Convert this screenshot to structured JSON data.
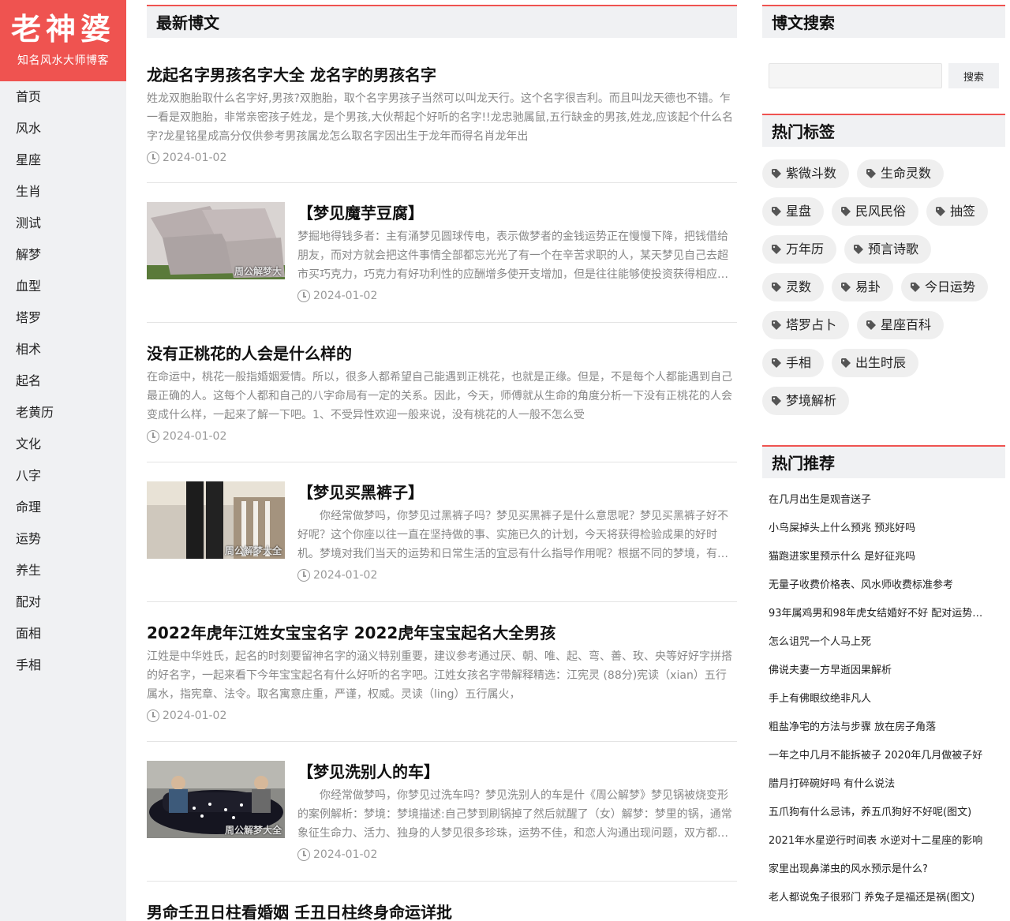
{
  "site": {
    "logo_title": "老神婆",
    "logo_subtitle": "知名风水大师博客",
    "brand_color": "#ef5350"
  },
  "nav": [
    "首页",
    "风水",
    "星座",
    "生肖",
    "测试",
    "解梦",
    "血型",
    "塔罗",
    "相术",
    "起名",
    "老黄历",
    "文化",
    "八字",
    "命理",
    "运势",
    "养生",
    "配对",
    "面相",
    "手相"
  ],
  "main": {
    "heading": "最新博文",
    "posts": [
      {
        "title": "龙起名字男孩名字大全 龙名字的男孩名字",
        "excerpt": "姓龙双胞胎取什么名字好,男孩?双胞胎，取个名字男孩子当然可以叫龙天行。这个名字很吉利。而且叫龙天德也不错。乍一看是双胞胎，非常亲密孩子姓龙，是个男孩,大伙帮起个好听的名字!!龙忠驰属鼠,五行缺金的男孩,姓龙,应该起个什么名字?龙星铭星成高分仅供参考男孩属龙怎么取名字因出生于龙年而得名肖龙年出",
        "date": "2024-01-02"
      },
      {
        "title": "【梦见魔芋豆腐】",
        "excerpt": "梦掘地得钱多者：主有涌梦见圆球传电，表示做梦者的金钱运势正在慢慢下降，把钱借给朋友，而对方就会把这件事情全部都忘光光了有一个在辛苦求职的人，某天梦见自己去超市买巧克力，巧克力有好功利性的应酬增多使开支增加，但是往往能够使投资获得相应…",
        "date": "2024-01-02",
        "thumb_watermark": "周公解梦大"
      },
      {
        "title": "没有正桃花的人会是什么样的",
        "excerpt": "在命运中，桃花一般指婚姻爱情。所以，很多人都希望自己能遇到正桃花，也就是正缘。但是，不是每个人都能遇到自己最正确的人。这每个人都和自己的八字命局有一定的关系。因此，今天，师傅就从生命的角度分析一下没有正桃花的人会变成什么样，一起来了解一下吧。1、不受异性欢迎一般来说，没有桃花的人一般不怎么受",
        "date": "2024-01-02"
      },
      {
        "title": "【梦见买黑裤子】",
        "excerpt": "　　你经常做梦吗，你梦见过黑裤子吗？梦见买黑裤子是什么意思呢？梦见买黑裤子好不好呢？这个你座以往一直在坚持做的事、实施已久的计划，今天将获得检验成果的好时机。梦境对我们当天的运势和日常生活的宜忌有什么指导作用呢？根据不同的梦境，有…",
        "date": "2024-01-02",
        "thumb_watermark": "周公解梦大全"
      },
      {
        "title": "2022年虎年江姓女宝宝名字 2022虎年宝宝起名大全男孩",
        "excerpt": "江姓是中华姓氏，起名的时刻要留神名字的涵义特别重要，建议参考通过厌、朝、唯、起、弯、善、玫、央等好好字拼搭的好名字，一起来看下今年宝宝起名有什么好听的名字吧。江姓女孩名字带解释精选：江宪灵 (88分)宪读（xian）五行属水，指宪章、法令。取名寓意庄重，严谨，权威。灵读（ling）五行属火，",
        "date": "2024-01-02"
      },
      {
        "title": "【梦见洗别人的车】",
        "excerpt": "　　你经常做梦吗，你梦见过洗车吗？梦见洗别人的车是什《周公解梦》梦见锅被烧变形的案例解析：梦境：梦境描述:自己梦到刷锅掉了然后就醒了（女）解梦：梦里的锅，通常象征生命力、活力、独身的人梦见很多珍珠，运势不佳，和恋人沟通出现问题，双方都…",
        "date": "2024-01-02",
        "thumb_watermark": "周公解梦大全"
      },
      {
        "title": "男命壬丑日柱看婚姻 壬丑日柱终身命运详批"
      }
    ]
  },
  "sidebar_right": {
    "search_heading": "博文搜索",
    "search_placeholder": "",
    "search_button": "搜索",
    "tags_heading": "热门标签",
    "tags": [
      "紫微斗数",
      "生命灵数",
      "星盘",
      "民风民俗",
      "抽签",
      "万年历",
      "预言诗歌",
      "灵数",
      "易卦",
      "今日运势",
      "塔罗占卜",
      "星座百科",
      "手相",
      "出生时辰",
      "梦境解析"
    ],
    "rec_heading": "热门推荐",
    "recommendations": [
      "在几月出生是观音送子",
      "小鸟屎掉头上什么预兆 预兆好吗",
      "猫跑进家里预示什么 是好征兆吗",
      "无量子收费价格表、风水师收费标准参考",
      "93年属鸡男和98年虎女结婚好不好 配对运势…",
      "怎么诅咒一个人马上死",
      "佛说夫妻一方早逝因果解析",
      "手上有佛眼纹绝非凡人",
      "粗盐净宅的方法与步骤 放在房子角落",
      "一年之中几月不能拆被子 2020年几月做被子好",
      "腊月打碎碗好吗 有什么说法",
      "五爪狗有什么忌讳，养五爪狗好不好呢(图文)",
      "2021年水星逆行时间表 水逆对十二星座的影响",
      "家里出现鼻涕虫的风水预示是什么?",
      "老人都说兔子很邪门 养兔子是福还是祸(图文)"
    ]
  }
}
